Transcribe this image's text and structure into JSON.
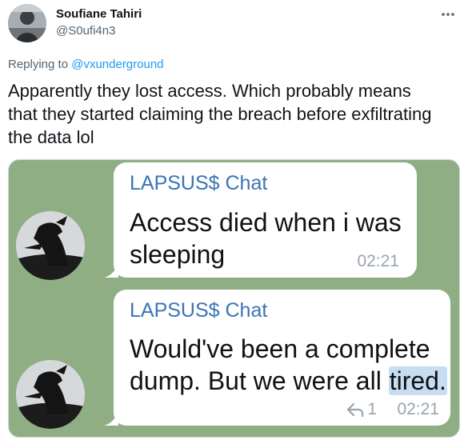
{
  "author": {
    "name": "Soufiane Tahiri",
    "handle": "@S0ufi4n3"
  },
  "replying": {
    "prefix": "Replying to ",
    "target": "@vxunderground"
  },
  "tweet": {
    "text_line1": "Apparently they lost access. Which probably means",
    "text_line2": "that they started claiming the breach before exfiltrating",
    "text_line3": "the data lol"
  },
  "chat": {
    "messages": [
      {
        "sender": "LAPSUS$ Chat",
        "line1": "Access died when i was",
        "line2": "sleeping",
        "time": "02:21"
      },
      {
        "sender": "LAPSUS$ Chat",
        "line1": "Would've been a complete",
        "line2_before": "dump. But we were all ",
        "line2_highlight": "tired.",
        "reply_count": "1",
        "time": "02:21"
      }
    ]
  },
  "colors": {
    "link": "#1d9bf0",
    "chat_background": "#8fae84",
    "sender_name": "#3a74b6",
    "highlight": "#c7ddf2"
  },
  "icons": {
    "more": "more-horizontal-icon",
    "reply": "reply-arrow-icon"
  }
}
